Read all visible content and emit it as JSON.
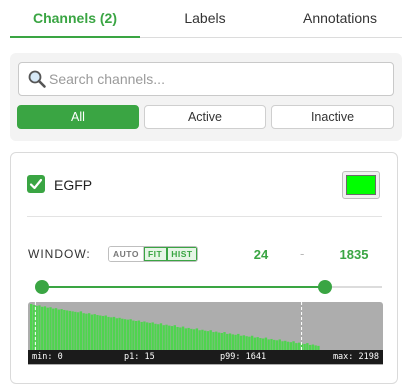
{
  "tabs": [
    {
      "label": "Channels (2)",
      "active": true
    },
    {
      "label": "Labels",
      "active": false
    },
    {
      "label": "Annotations",
      "active": false
    }
  ],
  "search": {
    "placeholder": "Search channels...",
    "value": "",
    "icon": "search-icon"
  },
  "filters": [
    {
      "label": "All",
      "active": true
    },
    {
      "label": "Active",
      "active": false
    },
    {
      "label": "Inactive",
      "active": false
    }
  ],
  "channel": {
    "name": "EGFP",
    "checked": true,
    "color": "#00ff00",
    "window": {
      "label": "WINDOW:",
      "modes": [
        {
          "label": "AUTO",
          "active": false
        },
        {
          "label": "FIT",
          "active": true
        },
        {
          "label": "HIST",
          "active": true
        }
      ],
      "min": "24",
      "separator": "-",
      "max": "1835"
    },
    "slider": {
      "range_min": 0,
      "range_max": 2198,
      "low": 24,
      "high": 1835
    },
    "histogram": {
      "stats": {
        "min": "min: 0",
        "p1": "p1: 15",
        "p99": "p99: 1641",
        "max": "max: 2198"
      },
      "range": [
        0,
        2198
      ],
      "p1_value": 15,
      "p99_value": 1641,
      "bins": [
        1.0,
        0.98,
        0.96,
        0.97,
        0.94,
        0.95,
        0.92,
        0.93,
        0.9,
        0.91,
        0.88,
        0.89,
        0.87,
        0.86,
        0.85,
        0.84,
        0.83,
        0.82,
        0.84,
        0.8,
        0.79,
        0.8,
        0.77,
        0.78,
        0.76,
        0.75,
        0.74,
        0.75,
        0.72,
        0.71,
        0.72,
        0.69,
        0.7,
        0.68,
        0.67,
        0.66,
        0.67,
        0.64,
        0.63,
        0.64,
        0.61,
        0.62,
        0.6,
        0.59,
        0.6,
        0.57,
        0.56,
        0.58,
        0.54,
        0.55,
        0.53,
        0.52,
        0.54,
        0.5,
        0.49,
        0.51,
        0.47,
        0.48,
        0.46,
        0.45,
        0.47,
        0.43,
        0.44,
        0.42,
        0.41,
        0.43,
        0.39,
        0.4,
        0.38,
        0.37,
        0.39,
        0.35,
        0.36,
        0.34,
        0.33,
        0.35,
        0.31,
        0.32,
        0.3,
        0.29,
        0.31,
        0.27,
        0.28,
        0.26,
        0.25,
        0.27,
        0.23,
        0.24,
        0.22,
        0.21,
        0.23,
        0.19,
        0.2,
        0.18,
        0.17,
        0.19,
        0.15,
        0.16,
        0.14,
        0.13,
        0.15,
        0.11,
        0.12,
        0.1,
        0.09
      ],
      "bar_color": "#4fd44f",
      "bg_color": "#adadad"
    }
  },
  "colors": {
    "accent": "#3aa543"
  }
}
